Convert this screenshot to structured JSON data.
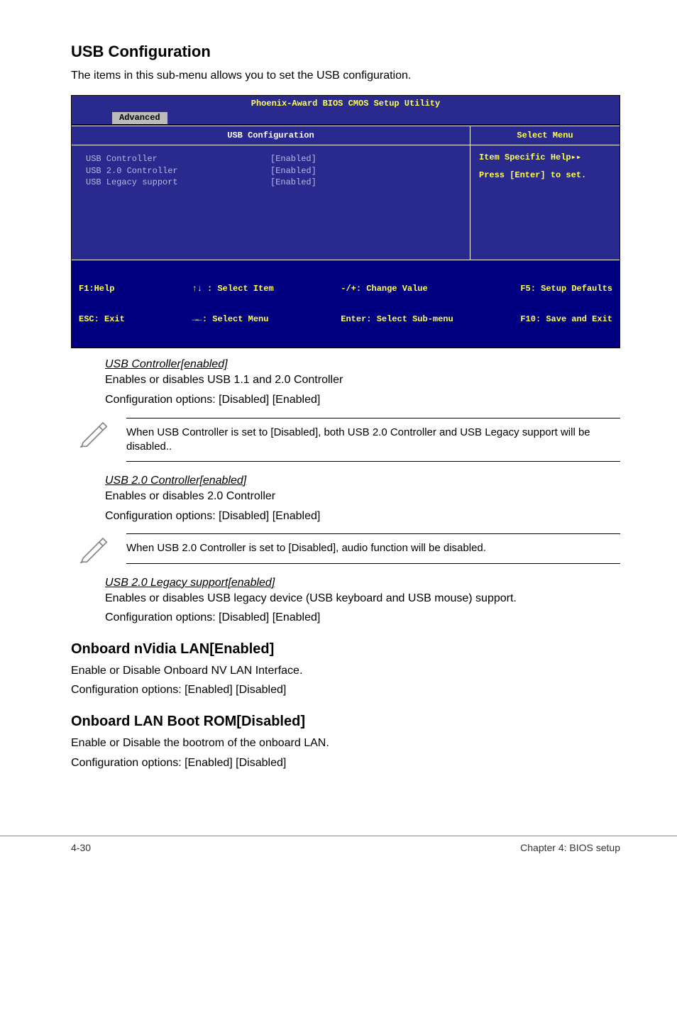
{
  "section_title": "USB Configuration",
  "section_lead": "The items in this sub-menu allows you to set the USB configuration.",
  "bios": {
    "title": "Phoenix-Award BIOS CMOS Setup Utility",
    "active_tab": "Advanced",
    "panel_title": "USB Configuration",
    "side_title": "Select Menu",
    "side_line1": "Item Specific Help▸▸",
    "side_line2": "Press [Enter] to set.",
    "rows": [
      {
        "label": "USB Controller",
        "value": "[Enabled]"
      },
      {
        "label": "USB 2.0 Controller",
        "value": "[Enabled]"
      },
      {
        "label": "USB Legacy support",
        "value": "[Enabled]"
      }
    ],
    "footer": {
      "c1a": "F1:Help",
      "c1b": "ESC: Exit",
      "c2a": "↑↓ : Select Item",
      "c2b": "→←: Select Menu",
      "c3a": "-/+: Change Value",
      "c3b": "Enter: Select Sub-menu",
      "c4a": "F5: Setup Defaults",
      "c4b": "F10: Save and Exit"
    }
  },
  "usb_controller": {
    "heading": "USB Controller[enabled]",
    "l1": "Enables or disables USB 1.1 and 2.0 Controller",
    "l2": "Configuration options: [Disabled] [Enabled]"
  },
  "note1": "When USB Controller is set to [Disabled], both USB 2.0 Controller and USB Legacy support will be disabled..",
  "usb20": {
    "heading": "USB 2.0 Controller[enabled]",
    "l1": "Enables or disables 2.0 Controller",
    "l2": "Configuration options: [Disabled] [Enabled]"
  },
  "note2": "When USB 2.0 Controller is set to [Disabled], audio function will be disabled.",
  "legacy": {
    "heading": "USB 2.0 Legacy support[enabled]",
    "l1": "Enables or disables USB legacy device (USB keyboard and USB mouse) support.",
    "l2": "Configuration options: [Disabled] [Enabled]"
  },
  "lan": {
    "heading": "Onboard nVidia LAN[Enabled]",
    "l1": "Enable or Disable Onboard NV LAN Interface.",
    "l2": "Configuration options: [Enabled] [Disabled]"
  },
  "bootrom": {
    "heading": "Onboard LAN Boot ROM[Disabled]",
    "l1": "Enable or Disable the bootrom of the onboard LAN.",
    "l2": "Configuration options: [Enabled] [Disabled]"
  },
  "footer_left": "4-30",
  "footer_right": "Chapter 4: BIOS setup"
}
